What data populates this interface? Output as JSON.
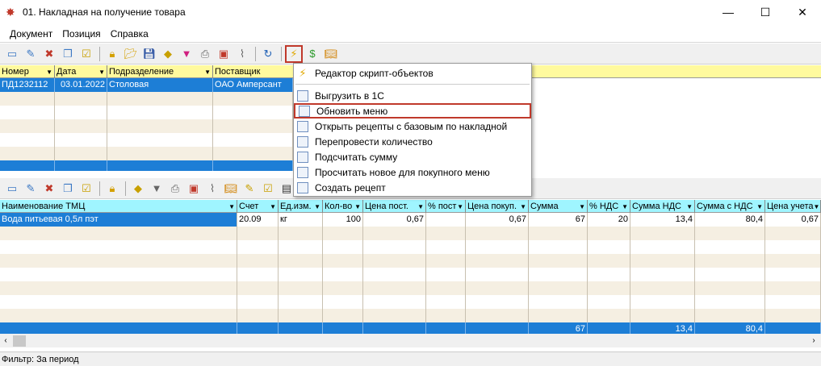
{
  "window": {
    "title": "01. Накладная на получение товара",
    "minimize": "—",
    "maximize": "☐",
    "close": "✕"
  },
  "menu": [
    "Документ",
    "Позиция",
    "Справка"
  ],
  "top_grid": {
    "headers": [
      "Номер",
      "Дата",
      "Подразделение",
      "Поставщик"
    ],
    "row": {
      "number": "ПД1232112",
      "date": "03.01.2022",
      "dept": "Столовая",
      "supplier": "ОАО Амперсант"
    }
  },
  "popup": {
    "items": [
      "Редактор скрипт-объектов",
      "Выгрузить в 1С",
      "Обновить меню",
      "Открыть рецепты с базовым по накладной",
      "Перепровести количество",
      "Подсчитать сумму",
      "Просчитать новое для покупного меню",
      "Создать рецепт"
    ]
  },
  "bottom_grid": {
    "headers": [
      "Наименование ТМЦ",
      "Счет",
      "Ед.изм.",
      "Кол-во",
      "Цена пост.",
      "% пост",
      "Цена покуп.",
      "Сумма",
      "% НДС",
      "Сумма НДС",
      "Сумма с НДС",
      "Цена учета"
    ],
    "row": [
      "Вода питьевая 0,5л пэт",
      "20.09",
      "кг",
      "100",
      "0,67",
      "",
      "0,67",
      "67",
      "20",
      "13,4",
      "80,4",
      "0,67"
    ],
    "totals": {
      "sum": "67",
      "vat_sum": "13,4",
      "sum_with_vat": "80,4"
    }
  },
  "status": {
    "filter": "Фильтр: За период"
  },
  "colors": {
    "selection": "#1d7ed6",
    "header_yellow": "#fffa9e",
    "header_cyan": "#9ff5ff",
    "highlight": "#c0392b"
  }
}
